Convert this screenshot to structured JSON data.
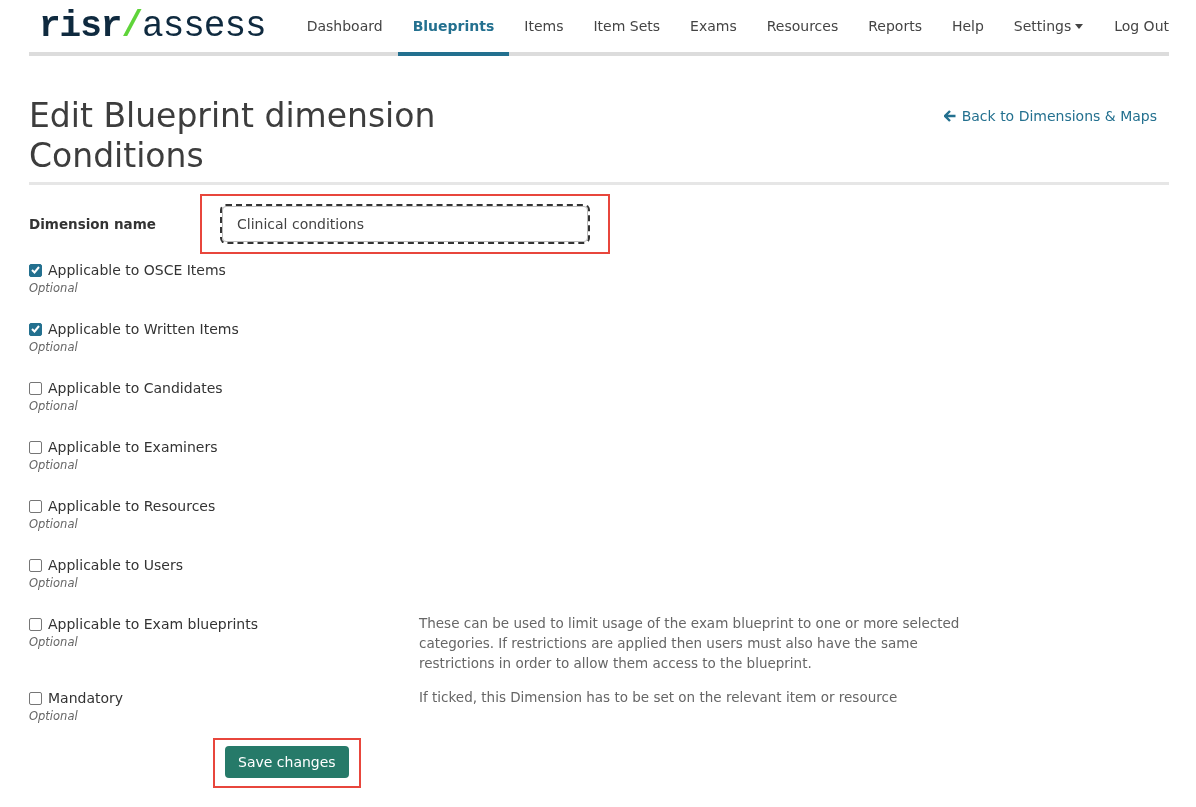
{
  "logo": {
    "brand": "risr",
    "separator": "/",
    "product": "assess"
  },
  "nav": {
    "items": [
      {
        "label": "Dashboard",
        "selected": false,
        "dropdown": false
      },
      {
        "label": "Blueprints",
        "selected": true,
        "dropdown": false
      },
      {
        "label": "Items",
        "selected": false,
        "dropdown": false
      },
      {
        "label": "Item Sets",
        "selected": false,
        "dropdown": false
      },
      {
        "label": "Exams",
        "selected": false,
        "dropdown": false
      },
      {
        "label": "Resources",
        "selected": false,
        "dropdown": false
      },
      {
        "label": "Reports",
        "selected": false,
        "dropdown": false
      },
      {
        "label": "Help",
        "selected": false,
        "dropdown": false
      },
      {
        "label": "Settings",
        "selected": false,
        "dropdown": true
      }
    ],
    "logout": "Log Out"
  },
  "header": {
    "title": "Edit Blueprint dimension",
    "subject": "Conditions",
    "back_link": "Back to Dimensions & Maps"
  },
  "form": {
    "name_field": {
      "label": "Dimension name",
      "value": "Clinical conditions",
      "focused": true,
      "highlighted": true
    },
    "options": [
      {
        "label": "Applicable to OSCE Items",
        "checked": true,
        "hint": "Optional"
      },
      {
        "label": "Applicable to Written Items",
        "checked": true,
        "hint": "Optional"
      },
      {
        "label": "Applicable to Candidates",
        "checked": false,
        "hint": "Optional"
      },
      {
        "label": "Applicable to Examiners",
        "checked": false,
        "hint": "Optional"
      },
      {
        "label": "Applicable to Resources",
        "checked": false,
        "hint": "Optional"
      },
      {
        "label": "Applicable to Users",
        "checked": false,
        "hint": "Optional"
      },
      {
        "label": "Applicable to Exam blueprints",
        "checked": false,
        "hint": "Optional",
        "help": "These can be used to limit usage of the exam blueprint to one or more selected categories. If restrictions are applied then users must also have the same restrictions in order to allow them access to the blueprint."
      },
      {
        "label": "Mandatory",
        "checked": false,
        "hint": "Optional",
        "help": "If ticked, this Dimension has to be set on the relevant item or resource"
      }
    ],
    "submit": {
      "label": "Save changes",
      "highlighted": true
    }
  }
}
